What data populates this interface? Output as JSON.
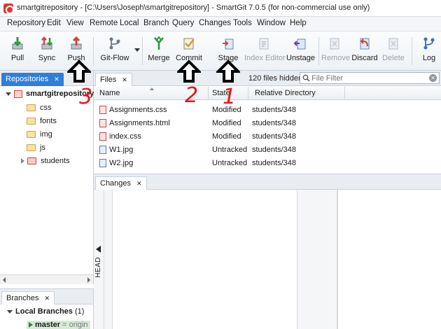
{
  "window": {
    "title": "smartgitrepository - [C:\\Users\\Joseph\\smartgitrepository] - SmartGit 7.0.5 (for non-commercial use only)"
  },
  "menu": [
    "Repository",
    "Edit",
    "View",
    "Remote",
    "Local",
    "Branch",
    "Query",
    "Changes",
    "Tools",
    "Window",
    "Help"
  ],
  "toolbar": {
    "pull": "Pull",
    "sync": "Sync",
    "push": "Push",
    "gitflow": "Git-Flow",
    "merge": "Merge",
    "commit": "Commit",
    "stage": "Stage",
    "index_editor": "Index Editor",
    "unstage": "Unstage",
    "remove": "Remove",
    "discard": "Discard",
    "delete": "Delete",
    "log": "Log"
  },
  "repositories": {
    "tab_label": "Repositories",
    "root": "smartgitrepository",
    "folders": [
      "css",
      "fonts",
      "img",
      "js",
      "students"
    ]
  },
  "branches": {
    "tab_label": "Branches",
    "local_branches_label": "Local Branches",
    "local_branches_count": "(1)",
    "master": "master",
    "origin": "= origin"
  },
  "files": {
    "tab_label": "Files",
    "hidden_count": "120 files hidden",
    "filter_placeholder": "File Filter",
    "columns": {
      "name": "Name",
      "state": "State",
      "relative_directory": "Relative Directory"
    },
    "rows": [
      {
        "name": "Assignments.css",
        "state": "Modified",
        "dir": "students/348",
        "type": "text"
      },
      {
        "name": "Assignments.html",
        "state": "Modified",
        "dir": "students/348",
        "type": "text"
      },
      {
        "name": "index.css",
        "state": "Modified",
        "dir": "students/348",
        "type": "text"
      },
      {
        "name": "W1.jpg",
        "state": "Untracked",
        "dir": "students/348",
        "type": "image"
      },
      {
        "name": "W2.jpg",
        "state": "Untracked",
        "dir": "students/348",
        "type": "image"
      }
    ]
  },
  "changes": {
    "tab_label": "Changes",
    "head_label": "HEAD"
  },
  "annotations": {
    "step1": "1",
    "step2": "2",
    "step3": "3",
    "color": "#e8151b"
  }
}
